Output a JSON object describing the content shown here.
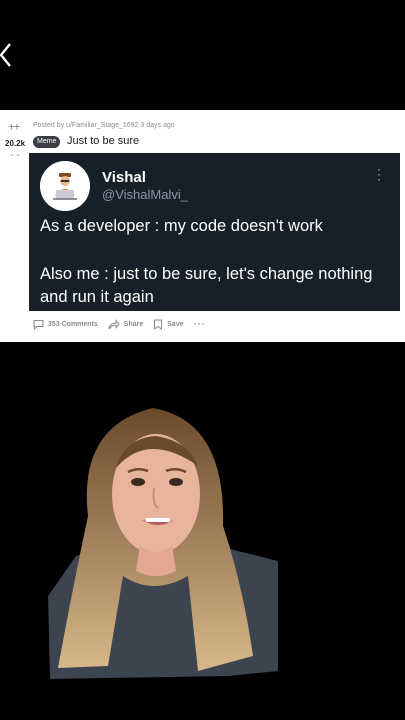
{
  "post": {
    "up_glyph": "++",
    "score": "20.2k",
    "down_glyph": "--",
    "meta": "Posted by u/Familiar_Stage_1692 3 days ago",
    "flair": "Meme",
    "title": "Just to be sure"
  },
  "tweet": {
    "author": "Vishal",
    "handle": "@VishalMalvi_",
    "more_glyph": "⋮",
    "line1": "As a developer : my code doesn't work",
    "line2": "Also me : just to be sure, let's change nothing and run it again"
  },
  "actions": {
    "comments": "353 Comments",
    "share": "Share",
    "save": "Save",
    "more": "···"
  },
  "icons": {
    "back": "chevron-left-icon",
    "comment": "comment-icon",
    "share": "share-icon",
    "save": "bookmark-icon"
  },
  "colors": {
    "background": "#000000",
    "card": "#ffffff",
    "tweet_bg": "#15202b",
    "tweet_handle": "#8b98a5",
    "flair_bg": "#3b3f45"
  }
}
